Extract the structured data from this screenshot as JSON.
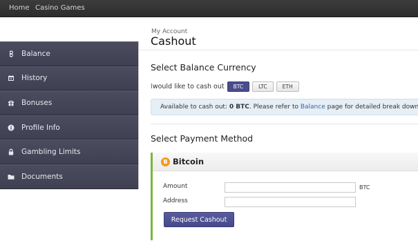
{
  "topnav": {
    "home": "Home",
    "casino_games": "Casino Games"
  },
  "sidebar": {
    "items": [
      {
        "label": "Balance",
        "icon": "bitcoin-icon"
      },
      {
        "label": "History",
        "icon": "calendar-icon"
      },
      {
        "label": "Bonuses",
        "icon": "gift-icon"
      },
      {
        "label": "Profile Info",
        "icon": "info-circle-icon"
      },
      {
        "label": "Gambling Limits",
        "icon": "lock-icon"
      },
      {
        "label": "Documents",
        "icon": "folder-icon"
      }
    ]
  },
  "main": {
    "breadcrumb": "My Account",
    "title": "Cashout",
    "currency_section": {
      "heading": "Select Balance Currency",
      "prompt_first": "I",
      "prompt_rest": " would like to cash out",
      "options": [
        "BTC",
        "LTC",
        "ETH"
      ],
      "selected": "BTC"
    },
    "info": {
      "prefix": "Available to cash out: ",
      "amount": "0 BTC",
      "middle": ". Please refer to ",
      "link": "Balance",
      "suffix": " page for detailed break down."
    },
    "payment_section": {
      "heading": "Select Payment Method",
      "method": "Bitcoin",
      "method_icon_glyph": "B",
      "amount_label": "Amount",
      "amount_value": "",
      "amount_unit": "BTC",
      "address_label": "Address",
      "address_value": "",
      "submit": "Request Cashout"
    }
  },
  "colors": {
    "sidebar_bg": "#434456",
    "accent_button": "#4a4d8c",
    "panel_border": "#7ab53f",
    "bitcoin": "#f29a1f",
    "info_bg": "#e6eef6",
    "link": "#3a62a8"
  }
}
